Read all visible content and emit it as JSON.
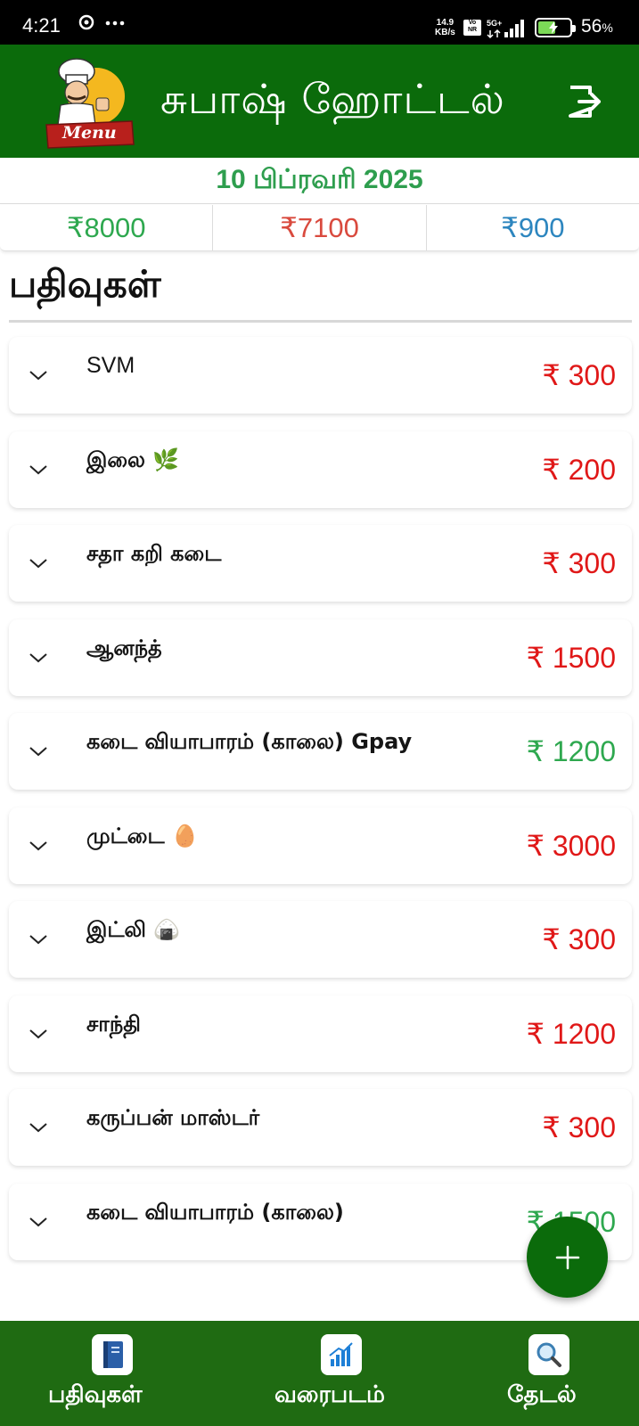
{
  "status_bar": {
    "time": "4:21",
    "net_speed_value": "14.9",
    "net_speed_unit": "KB/s",
    "volte_top": "Vo",
    "volte_bottom": "NR",
    "network_type": "5G+",
    "battery_percent": "56",
    "battery_symbol": "%"
  },
  "header": {
    "title": "சுபாஷ் ஹோட்டல்",
    "logo_text": "Menu",
    "logout_icon": "logout-icon",
    "color": "#0b6b0b"
  },
  "date": "10 பிப்ரவரி 2025",
  "summary": {
    "income": "₹8000",
    "expense": "₹7100",
    "balance": "₹900",
    "colors": {
      "income": "#2ea84f",
      "expense": "#d94a3e",
      "balance": "#2d86bf"
    }
  },
  "section_title": "பதிவுகள்",
  "entries": [
    {
      "name": "SVM",
      "amount": "₹ 300",
      "type": "expense"
    },
    {
      "name": "இலை 🌿",
      "amount": "₹ 200",
      "type": "expense"
    },
    {
      "name": "சதா கறி கடை",
      "amount": "₹ 300",
      "type": "expense"
    },
    {
      "name": "ஆனந்த்",
      "amount": "₹ 1500",
      "type": "expense"
    },
    {
      "name": "கடை வியாபாரம் (காலை) Gpay",
      "amount": "₹ 1200",
      "type": "income"
    },
    {
      "name": "முட்டை 🥚",
      "amount": "₹ 3000",
      "type": "expense"
    },
    {
      "name": "இட்லி 🍙",
      "amount": "₹ 300",
      "type": "expense"
    },
    {
      "name": "சாந்தி",
      "amount": "₹ 1200",
      "type": "expense"
    },
    {
      "name": "கருப்பன் மாஸ்டர்",
      "amount": "₹ 300",
      "type": "expense"
    },
    {
      "name": "கடை வியாபாரம் (காலை)",
      "amount": "₹ 1500",
      "type": "income"
    }
  ],
  "fab": {
    "icon": "plus-icon"
  },
  "bottom_nav": [
    {
      "label": "பதிவுகள்",
      "icon": "notebook-icon"
    },
    {
      "label": "வரைபடம்",
      "icon": "chart-icon"
    },
    {
      "label": "தேடல்",
      "icon": "search-icon"
    }
  ]
}
